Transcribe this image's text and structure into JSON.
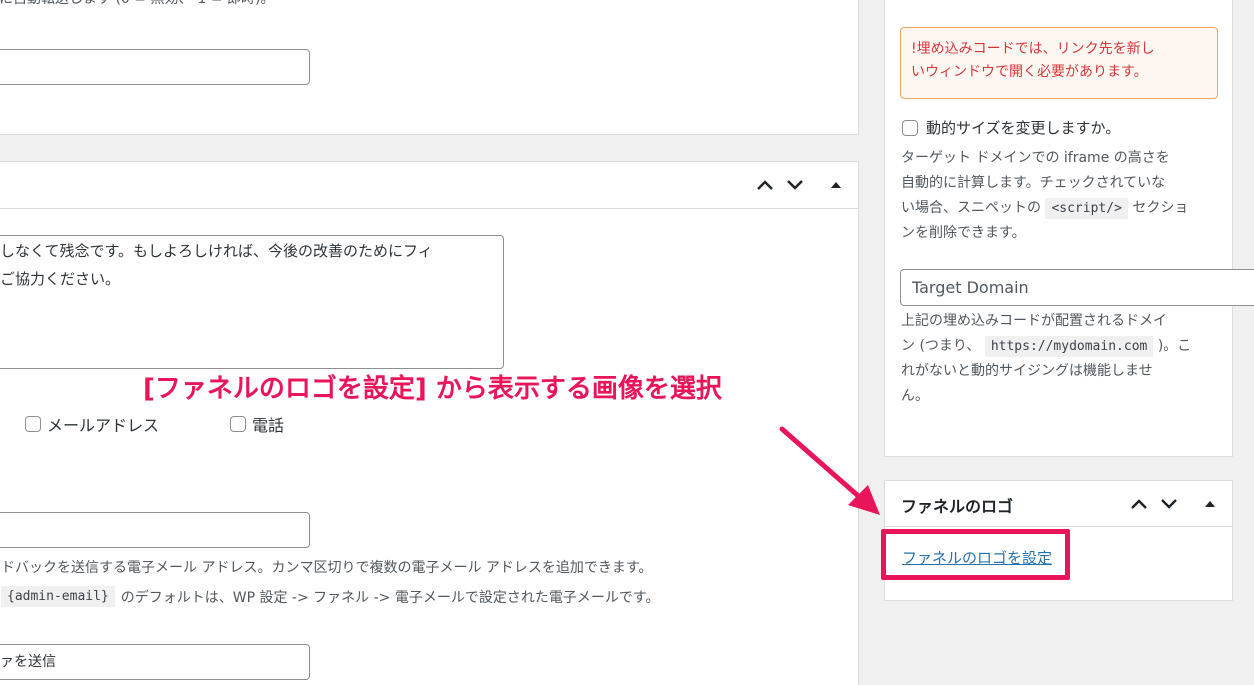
{
  "left_panel_top": {
    "partial_line": "に自動転送します (0 = 無効、-1 = 即時)。"
  },
  "feedback_panel": {
    "message_line1": "しなくて残念です。もしよろしければ、今後の改善のためにフィ",
    "message_line2": "ご協力ください。",
    "checkbox_email_label": "メールアドレス",
    "checkbox_phone_label": "電話",
    "email_help_line1": "ドバックを送信する電子メール アドレス。カンマ区切りで複数の電子メール アドレスを追加できます。",
    "email_help_code": "{admin-email}",
    "email_help_line2": "のデフォルトは、WP 設定 -> ファネル -> 電子メールで設定された電子メールです。",
    "submit_text_value": "ァを送信"
  },
  "sidebar": {
    "notice_line1": "!埋め込みコードでは、リンク先を新し",
    "notice_line2": "いウィンドウで開く必要があります。",
    "dynamic_size_label": "動的サイズを変更しますか。",
    "dynamic_help_line1": "ターゲット ドメインでの iframe の高さを",
    "dynamic_help_line2": "自動的に計算します。チェックされていな",
    "dynamic_help_line3_pre": "い場合、スニペットの",
    "dynamic_help_code": "<script/>",
    "dynamic_help_line3_post": "セクショ",
    "dynamic_help_line4": "ンを削除できます。",
    "target_domain_placeholder": "Target Domain",
    "target_help_line1": "上記の埋め込みコードが配置されるドメイ",
    "target_help_line2_pre": "ン (つまり、",
    "target_help_code": "https://mydomain.com",
    "target_help_line2_post": ")。こ",
    "target_help_line3": "れがないと動的サイジングは機能しませ",
    "target_help_line4": "ん。"
  },
  "funnel_logo": {
    "title": "ファネルのロゴ",
    "set_link": "ファネルのロゴを設定"
  },
  "annotation": {
    "callout": "[ファネルのロゴを設定] から表示する画像を選択",
    "accent_color": "#e8155a"
  }
}
